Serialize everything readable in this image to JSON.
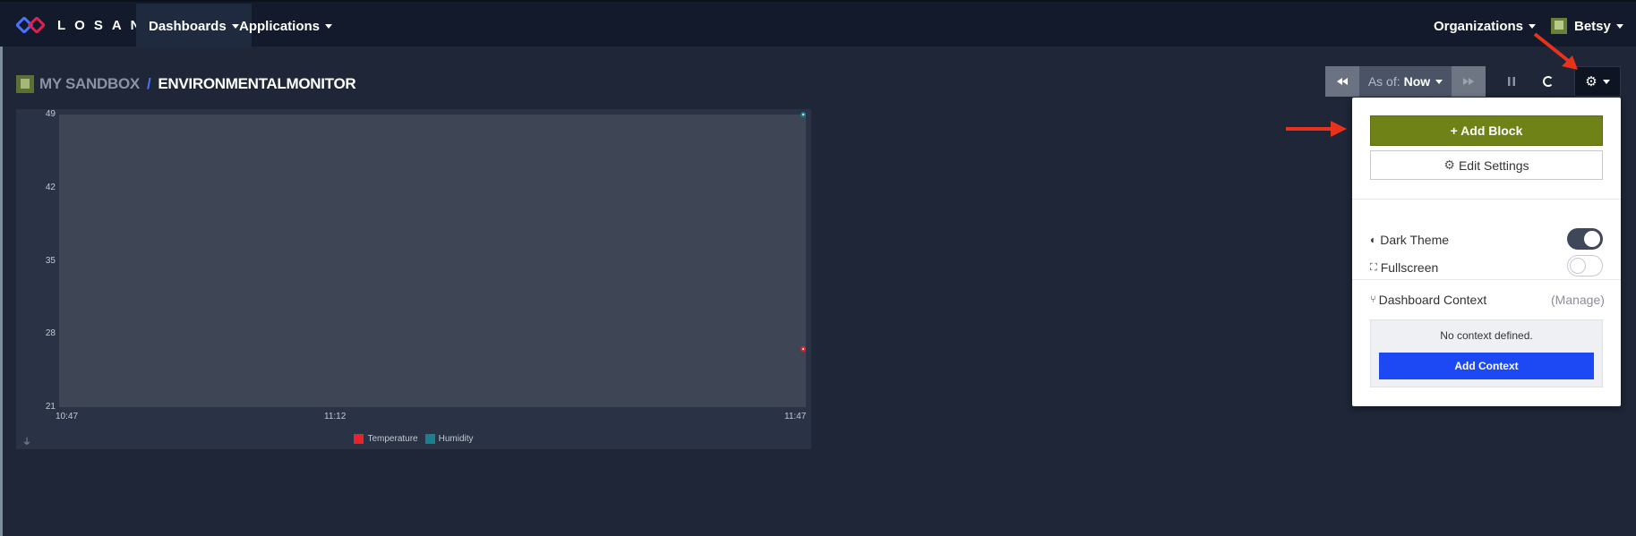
{
  "brand": {
    "name": "LOSANT",
    "accent": "#4a72ff"
  },
  "nav": {
    "dashboards": "Dashboards",
    "applications": "Applications",
    "organizations": "Organizations",
    "user": "Betsy"
  },
  "breadcrumb": {
    "sandbox": "My Sandbox",
    "separator": "/",
    "dashboard": "EnvironmentalMonitor"
  },
  "time_controls": {
    "as_of_label": "As of:",
    "as_of_value": "Now"
  },
  "settings_menu": {
    "add_block": "+ Add Block",
    "edit_settings": "Edit Settings",
    "dark_theme": {
      "label": "Dark Theme",
      "enabled": true
    },
    "fullscreen": {
      "label": "Fullscreen",
      "enabled": false
    },
    "context_label": "Dashboard Context",
    "manage": "(Manage)",
    "no_context": "No context defined.",
    "add_context": "Add Context"
  },
  "chart_data": {
    "type": "line",
    "y_ticks": [
      "49",
      "42",
      "35",
      "28",
      "21"
    ],
    "x_ticks": [
      "10:47",
      "11:12",
      "11:47"
    ],
    "ylim": [
      21,
      49
    ],
    "series": [
      {
        "name": "Temperature",
        "color": "#e8232a",
        "points": [
          {
            "x": "11:47",
            "y": 26.6
          }
        ]
      },
      {
        "name": "Humidity",
        "color": "#1a7f8e",
        "points": [
          {
            "x": "11:47",
            "y": 49
          }
        ]
      }
    ]
  },
  "colors": {
    "add_block": "#6e8218",
    "add_context": "#1d49f5",
    "annotation_arrow": "#e8321c"
  }
}
